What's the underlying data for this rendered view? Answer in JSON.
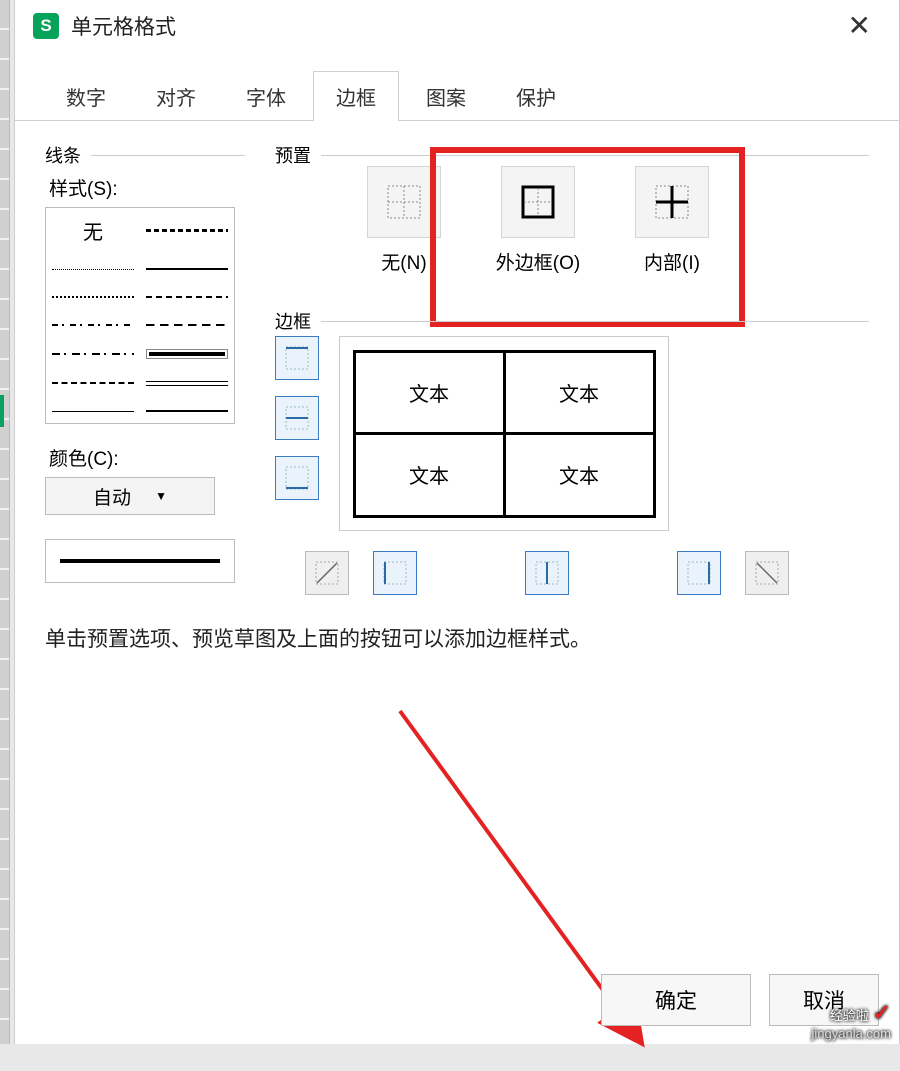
{
  "dialog": {
    "title": "单元格格式",
    "close_glyph": "✕"
  },
  "tabs": {
    "items": [
      "数字",
      "对齐",
      "字体",
      "边框",
      "图案",
      "保护"
    ],
    "active_index": 3
  },
  "line": {
    "group_label": "线条",
    "style_label": "样式(S):",
    "none_label": "无",
    "color_label": "颜色(C):",
    "color_value": "自动"
  },
  "preset": {
    "group_label": "预置",
    "items": [
      {
        "label": "无(N)"
      },
      {
        "label": "外边框(O)"
      },
      {
        "label": "内部(I)"
      }
    ]
  },
  "border": {
    "group_label": "边框",
    "sample_text": "文本"
  },
  "hint_text": "单击预置选项、预览草图及上面的按钮可以添加边框样式。",
  "buttons": {
    "ok": "确定",
    "cancel": "取消"
  },
  "watermark": {
    "brand": "经验啦",
    "url": "jingyanla.com"
  }
}
